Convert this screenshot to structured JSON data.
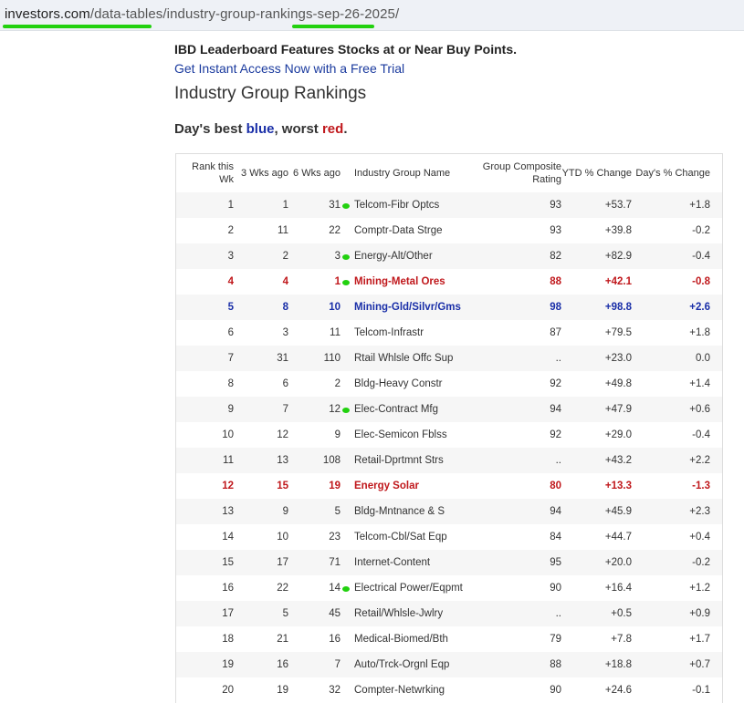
{
  "address_bar": {
    "host": "investors.com",
    "path": "/data-tables/industry-group-rankings-sep-26-2025/"
  },
  "promo": {
    "headline": "IBD Leaderboard Features Stocks at or Near Buy Points.",
    "link": "Get Instant Access Now with a Free Trial"
  },
  "page_title": "Industry Group Rankings",
  "legend": {
    "prefix": "Day's best ",
    "best": "blue",
    "mid": ", worst ",
    "worst": "red",
    "suffix": "."
  },
  "colors": {
    "best": "#1a2fa8",
    "worst": "#c0181c",
    "annotation": "#22d10f"
  },
  "table": {
    "headers": [
      "Rank this Wk",
      "3 Wks ago",
      "6 Wks ago",
      "Industry Group Name",
      "Group Composite Rating",
      "YTD % Change",
      "Day's % Change"
    ],
    "rows": [
      {
        "cells": [
          "1",
          "1",
          "31",
          "Telcom-Fibr Optcs",
          "93",
          "+53.7",
          "+1.8"
        ],
        "style": "",
        "marked": true
      },
      {
        "cells": [
          "2",
          "11",
          "22",
          "Comptr-Data Strge",
          "93",
          "+39.8",
          "-0.2"
        ],
        "style": "",
        "marked": false
      },
      {
        "cells": [
          "3",
          "2",
          "3",
          "Energy-Alt/Other",
          "82",
          "+82.9",
          "-0.4"
        ],
        "style": "",
        "marked": true
      },
      {
        "cells": [
          "4",
          "4",
          "1",
          "Mining-Metal Ores",
          "88",
          "+42.1",
          "-0.8"
        ],
        "style": "red",
        "marked": true
      },
      {
        "cells": [
          "5",
          "8",
          "10",
          "Mining-Gld/Silvr/Gms",
          "98",
          "+98.8",
          "+2.6"
        ],
        "style": "blue",
        "marked": false
      },
      {
        "cells": [
          "6",
          "3",
          "11",
          "Telcom-Infrastr",
          "87",
          "+79.5",
          "+1.8"
        ],
        "style": "",
        "marked": false
      },
      {
        "cells": [
          "7",
          "31",
          "110",
          "Rtail Whlsle Offc Sup",
          "..",
          "+23.0",
          "0.0"
        ],
        "style": "",
        "marked": false
      },
      {
        "cells": [
          "8",
          "6",
          "2",
          "Bldg-Heavy Constr",
          "92",
          "+49.8",
          "+1.4"
        ],
        "style": "",
        "marked": false
      },
      {
        "cells": [
          "9",
          "7",
          "12",
          "Elec-Contract Mfg",
          "94",
          "+47.9",
          "+0.6"
        ],
        "style": "",
        "marked": true
      },
      {
        "cells": [
          "10",
          "12",
          "9",
          "Elec-Semicon Fblss",
          "92",
          "+29.0",
          "-0.4"
        ],
        "style": "",
        "marked": false
      },
      {
        "cells": [
          "11",
          "13",
          "108",
          "Retail-Dprtmnt Strs",
          "..",
          "+43.2",
          "+2.2"
        ],
        "style": "",
        "marked": false
      },
      {
        "cells": [
          "12",
          "15",
          "19",
          "Energy Solar",
          "80",
          "+13.3",
          "-1.3"
        ],
        "style": "red",
        "marked": false
      },
      {
        "cells": [
          "13",
          "9",
          "5",
          "Bldg-Mntnance & S",
          "94",
          "+45.9",
          "+2.3"
        ],
        "style": "",
        "marked": false
      },
      {
        "cells": [
          "14",
          "10",
          "23",
          "Telcom-Cbl/Sat Eqp",
          "84",
          "+44.7",
          "+0.4"
        ],
        "style": "",
        "marked": false
      },
      {
        "cells": [
          "15",
          "17",
          "71",
          "Internet-Content",
          "95",
          "+20.0",
          "-0.2"
        ],
        "style": "",
        "marked": false
      },
      {
        "cells": [
          "16",
          "22",
          "14",
          "Electrical Power/Eqpmt",
          "90",
          "+16.4",
          "+1.2"
        ],
        "style": "",
        "marked": true
      },
      {
        "cells": [
          "17",
          "5",
          "45",
          "Retail/Whlsle-Jwlry",
          "..",
          "+0.5",
          "+0.9"
        ],
        "style": "",
        "marked": false
      },
      {
        "cells": [
          "18",
          "21",
          "16",
          "Medical-Biomed/Bth",
          "79",
          "+7.8",
          "+1.7"
        ],
        "style": "",
        "marked": false
      },
      {
        "cells": [
          "19",
          "16",
          "7",
          "Auto/Trck-Orgnl Eqp",
          "88",
          "+18.8",
          "+0.7"
        ],
        "style": "",
        "marked": false
      },
      {
        "cells": [
          "20",
          "19",
          "32",
          "Compter-Netwrking",
          "90",
          "+24.6",
          "-0.1"
        ],
        "style": "",
        "marked": false
      }
    ]
  }
}
